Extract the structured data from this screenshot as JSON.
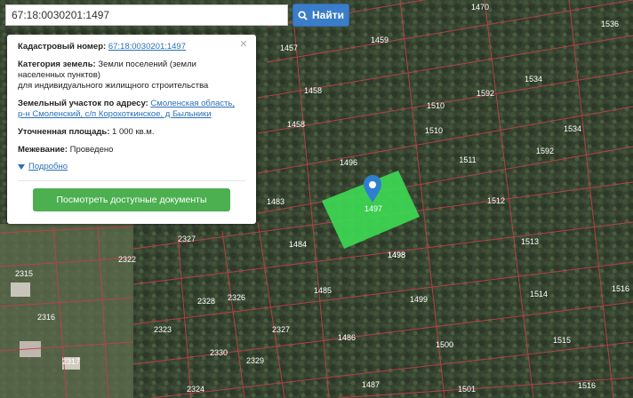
{
  "search": {
    "value": "67:18:0030201:1497",
    "button_label": "Найти"
  },
  "info": {
    "cadastral_label": "Кадастровый номер:",
    "cadastral_value": "67:18:0030201:1497",
    "category_label": "Категория земель:",
    "category_value_1": "Земли поселений (земли",
    "category_value_2": "населенных пунктов)",
    "category_value_3": "для индивидуального жилищного строительства",
    "address_label": "Земельный участок по адресу:",
    "address_value_1": "Смоленская область,",
    "address_value_2": "р-н Смоленский, с/п Корохоткинское, д Быльники",
    "area_label": "Уточненная площадь:",
    "area_value": "1 000 кв.м.",
    "survey_label": "Межевание:",
    "survey_value": "Проведено",
    "more_link": "Подробно",
    "docs_button": "Посмотреть доступные документы"
  },
  "map": {
    "selected_label": "1497",
    "parcels": [
      "1470",
      "1536",
      "1457",
      "1459",
      "1458",
      "1592",
      "1534",
      "1458",
      "1510",
      "1510",
      "1534",
      "1498",
      "1496",
      "1511",
      "1592",
      "1483",
      "1512",
      "2327",
      "1484",
      "1513",
      "2322",
      "1498",
      "2315",
      "1485",
      "1499",
      "1514",
      "1516",
      "2328",
      "2326",
      "2316",
      "2323",
      "2327",
      "1486",
      "1500",
      "1515",
      "2330",
      "2329",
      "2317",
      "1487",
      "1501",
      "1516",
      "2324"
    ],
    "colors": {
      "selected_fill": "#3ddc54",
      "boundary": "#c0404a",
      "marker": "#2f7fd0",
      "button_blue": "#3a7dc9",
      "button_green": "#4caf50",
      "link": "#2a6fb8"
    },
    "icons": [
      "search-icon",
      "map-marker-icon",
      "close-icon",
      "caret-down-icon"
    ]
  }
}
